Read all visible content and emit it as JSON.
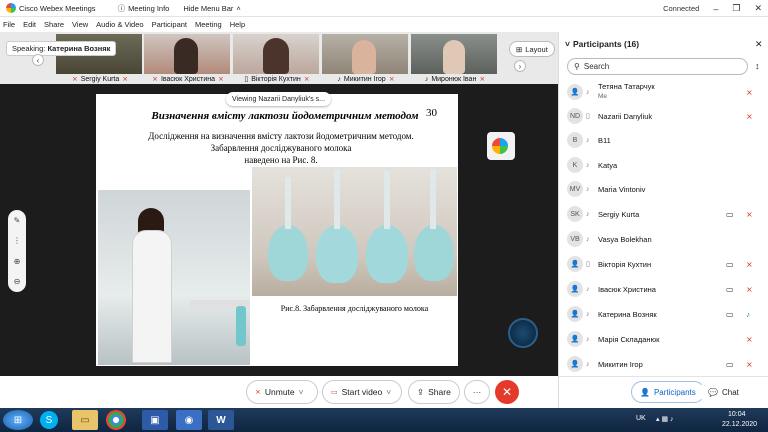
{
  "window": {
    "app_title": "Cisco Webex Meetings",
    "meeting_info": "Meeting Info",
    "hide_menu_bar": "Hide Menu Bar",
    "status": "Connected"
  },
  "menu": [
    "File",
    "Edit",
    "Share",
    "View",
    "Audio & Video",
    "Participant",
    "Meeting",
    "Help"
  ],
  "strip": {
    "speaking_prefix": "Speaking:",
    "speaking_name": "Катерина Возняк",
    "layout_label": "Layout",
    "tiles": [
      {
        "name": "Sergiy Kurta"
      },
      {
        "name": "Івасюк Христина"
      },
      {
        "name": "Вікторія Кухтин"
      },
      {
        "name": "Микитин Ігор"
      },
      {
        "name": "Миронюк Іван"
      }
    ]
  },
  "share": {
    "viewing": "Viewing Nazarii Danyliuk's s...",
    "slide": {
      "title": "Визначення вмісту лактози йодометричним методом",
      "number": "30",
      "line1": "Дослідження на визначення вмісту лактози йодометричним методом.",
      "line2": "Забарвлення досліджуваного молока",
      "line3": "наведено на Рис. 8.",
      "caption": "Рис.8. Забарвлення досліджуваного молока"
    }
  },
  "controls": {
    "unmute": "Unmute",
    "start_video": "Start video",
    "share": "Share",
    "more": "···"
  },
  "panel": {
    "title": "Participants (16)",
    "search_placeholder": "Search",
    "participants": [
      {
        "initials": "",
        "name": "Тетяна Татарчук",
        "sub": "Me",
        "camera": false
      },
      {
        "initials": "ND",
        "name": "Nazarii Danyliuk",
        "sub": "",
        "camera": false
      },
      {
        "initials": "B",
        "name": "B11",
        "sub": "",
        "camera": false
      },
      {
        "initials": "K",
        "name": "Katya",
        "sub": "",
        "camera": false
      },
      {
        "initials": "MV",
        "name": "Maria Vintoniv",
        "sub": "",
        "camera": false
      },
      {
        "initials": "SK",
        "name": "Sergiy Kurta",
        "sub": "",
        "camera": true
      },
      {
        "initials": "VB",
        "name": "Vasya Bolekhan",
        "sub": "",
        "camera": false
      },
      {
        "initials": "",
        "name": "Вікторія Кухтин",
        "sub": "",
        "camera": true
      },
      {
        "initials": "",
        "name": "Івасюк Христина",
        "sub": "",
        "camera": true
      },
      {
        "initials": "",
        "name": "Катерина Возняк",
        "sub": "",
        "camera": true
      },
      {
        "initials": "",
        "name": "Марія Складанюк",
        "sub": "",
        "camera": false
      },
      {
        "initials": "",
        "name": "Микитин Ігор",
        "sub": "",
        "camera": true
      }
    ],
    "footer_participants": "Participants",
    "footer_chat": "Chat"
  },
  "taskbar": {
    "lang": "UK",
    "time": "10:04",
    "date": "22.12.2020"
  },
  "colors": {
    "mute": "#d0392b",
    "end_call": "#e5392c",
    "accent": "#0a63c9"
  }
}
